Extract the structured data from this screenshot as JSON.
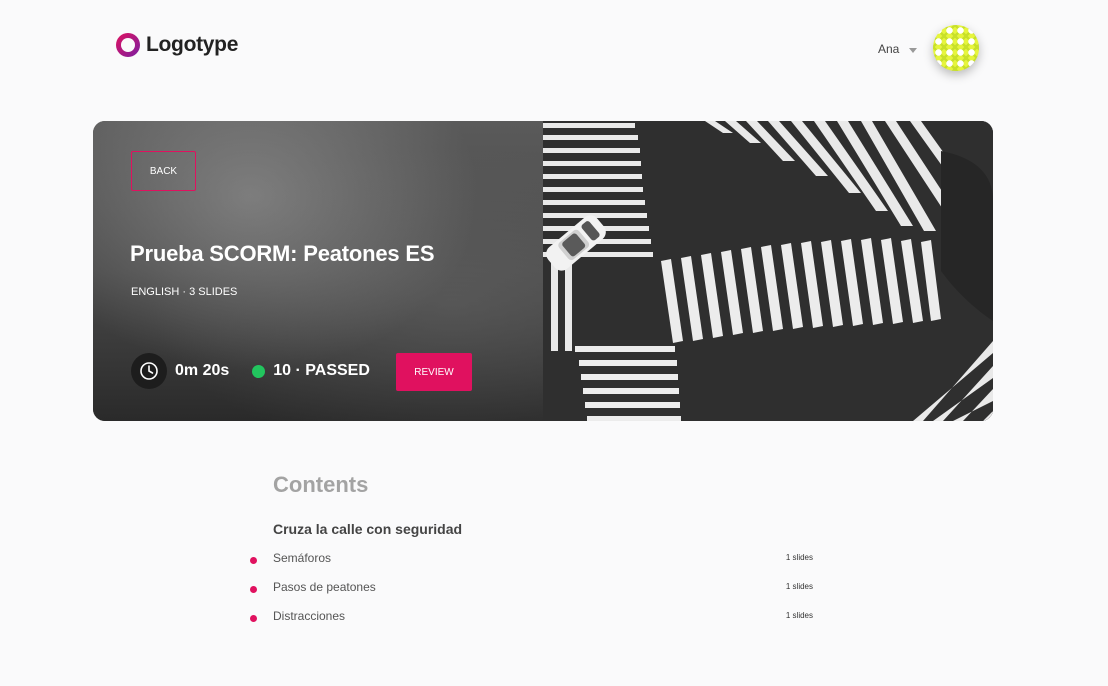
{
  "header": {
    "logo_text": "Logotype",
    "user_name": "Ana"
  },
  "hero": {
    "back_label": "BACK",
    "title": "Prueba SCORM: Peatones ES",
    "meta": "ENGLISH · 3 SLIDES",
    "time": "0m 20s",
    "score_status": "10 · PASSED",
    "review_label": "REVIEW"
  },
  "contents": {
    "heading": "Contents",
    "section_title": "Cruza la calle con seguridad",
    "items": [
      {
        "label": "Semáforos",
        "count": "1 slides"
      },
      {
        "label": "Pasos de peatones",
        "count": "1 slides"
      },
      {
        "label": "Distracciones",
        "count": "1 slides"
      }
    ]
  },
  "colors": {
    "accent": "#e0115f",
    "status_passed": "#22c55e",
    "avatar": "#e6f53d"
  },
  "icons": [
    "logo-ring-icon",
    "chevron-down-icon",
    "clock-icon"
  ]
}
